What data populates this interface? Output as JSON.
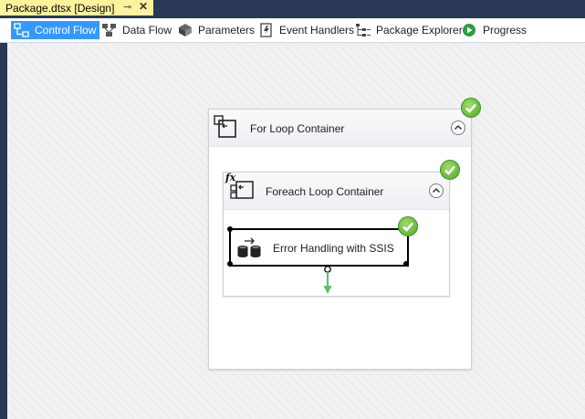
{
  "document_tab": {
    "title": "Package.dtsx [Design]",
    "pin_glyph": "⊸",
    "close_glyph": "✕"
  },
  "designer_tabs": [
    {
      "label": "Control Flow",
      "icon": "control-flow-icon",
      "active": true
    },
    {
      "label": "Data Flow",
      "icon": "data-flow-icon",
      "active": false
    },
    {
      "label": "Parameters",
      "icon": "parameters-icon",
      "active": false
    },
    {
      "label": "Event Handlers",
      "icon": "event-handlers-icon",
      "active": false
    },
    {
      "label": "Package Explorer",
      "icon": "package-explorer-icon",
      "active": false
    },
    {
      "label": "Progress",
      "icon": "progress-icon",
      "active": false
    }
  ],
  "canvas": {
    "for_loop": {
      "title": "For Loop Container",
      "icon": "for-loop-icon",
      "status": "success",
      "foreach_loop": {
        "title": "Foreach Loop Container",
        "icon": "foreach-loop-icon",
        "icon_label": "fx",
        "status": "success",
        "task": {
          "title": "Error Handling with SSIS",
          "icon": "execute-sql-task-icon",
          "status": "success"
        }
      }
    }
  },
  "colors": {
    "chrome": "#293955",
    "tab_highlight": "#fff29d",
    "active_tab": "#3399ff",
    "success": "#4ea82a",
    "precedence_arrow": "#5bbf6a"
  }
}
